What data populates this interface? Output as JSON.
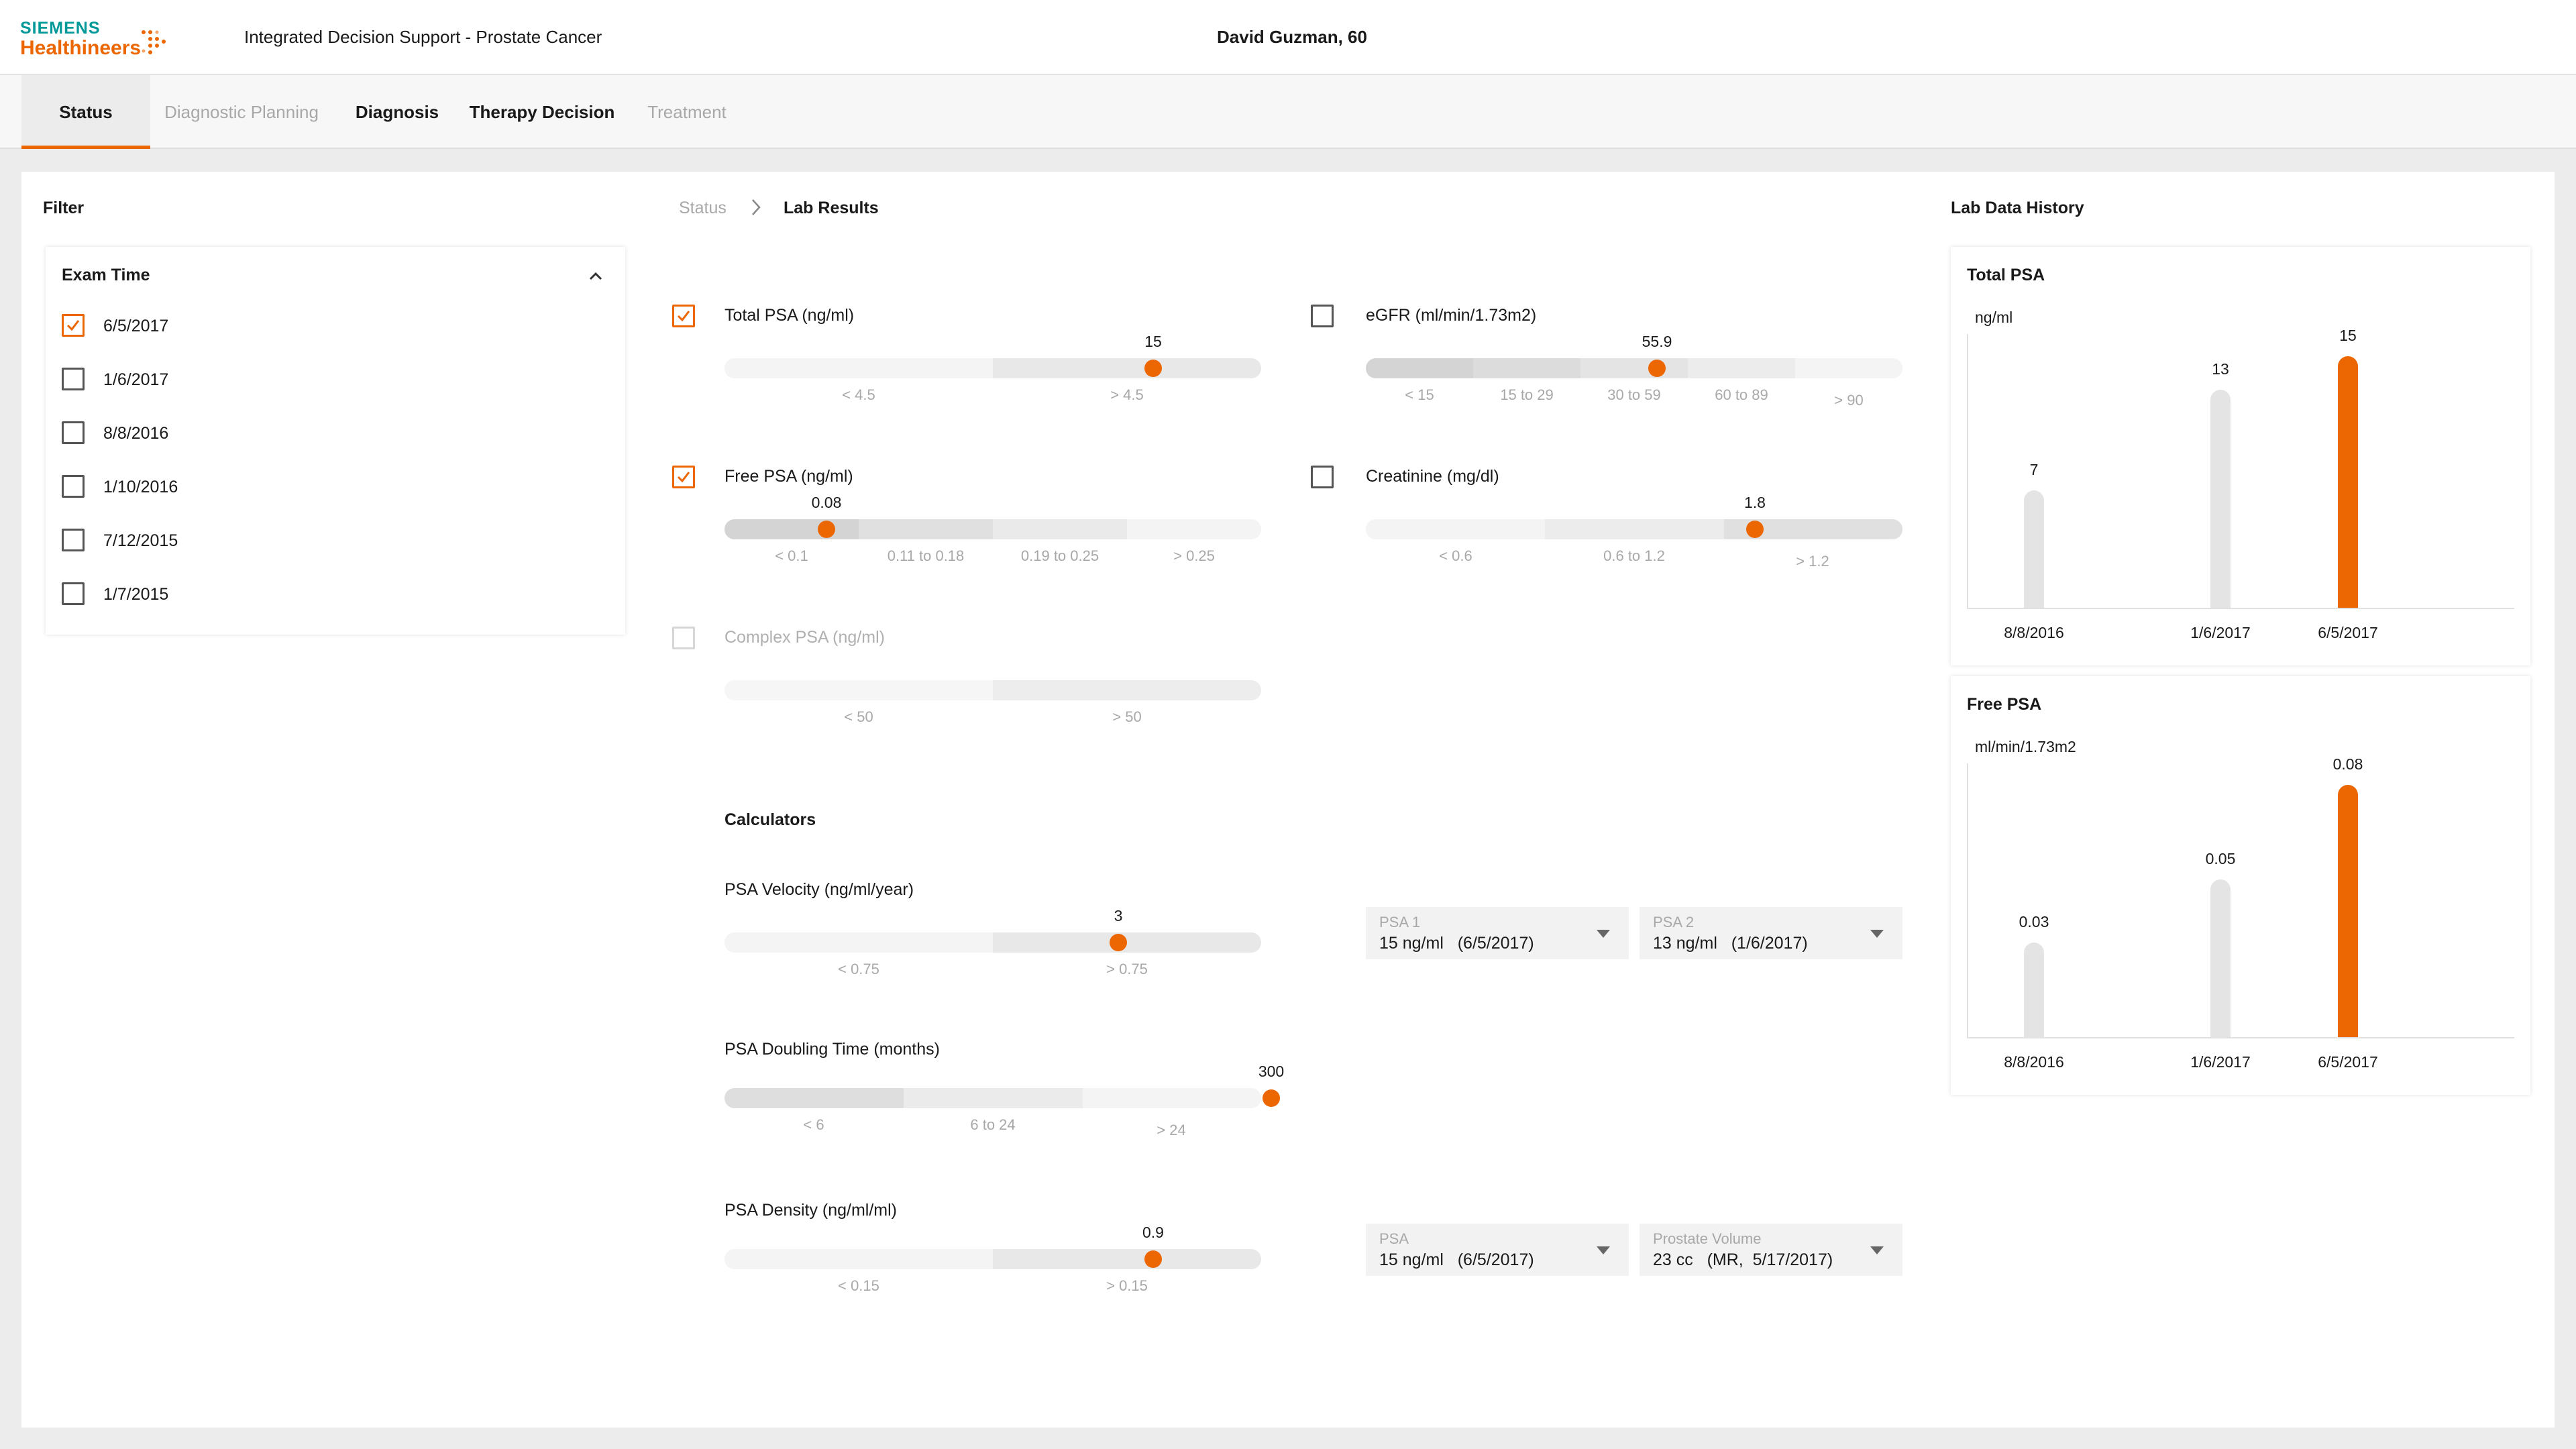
{
  "header": {
    "brand_line1": "SIEMENS",
    "brand_line2": "Healthineers",
    "app_title": "Integrated Decision Support - Prostate Cancer",
    "patient": "David Guzman, 60"
  },
  "tabs": [
    {
      "label": "Status",
      "state": "active"
    },
    {
      "label": "Diagnostic Planning",
      "state": "disabled"
    },
    {
      "label": "Diagnosis",
      "state": "enabled"
    },
    {
      "label": "Therapy Decision",
      "state": "enabled"
    },
    {
      "label": "Treatment",
      "state": "disabled"
    }
  ],
  "filter": {
    "title": "Filter",
    "group_title": "Exam Time",
    "items": [
      {
        "label": "6/5/2017",
        "checked": true
      },
      {
        "label": "1/6/2017",
        "checked": false
      },
      {
        "label": "8/8/2016",
        "checked": false
      },
      {
        "label": "1/10/2016",
        "checked": false
      },
      {
        "label": "7/12/2015",
        "checked": false
      },
      {
        "label": "1/7/2015",
        "checked": false
      }
    ]
  },
  "breadcrumb": {
    "parent": "Status",
    "current": "Lab Results"
  },
  "lab_results": {
    "total_psa": {
      "label": "Total PSA (ng/ml)",
      "checked": true,
      "value": "15",
      "ranges": [
        "< 4.5",
        "> 4.5"
      ]
    },
    "free_psa": {
      "label": "Free PSA (ng/ml)",
      "checked": true,
      "value": "0.08",
      "ranges": [
        "< 0.1",
        "0.11 to 0.18",
        "0.19 to 0.25",
        "> 0.25"
      ]
    },
    "complex_psa": {
      "label": "Complex PSA (ng/ml)",
      "checked": false,
      "disabled": true,
      "ranges": [
        "< 50",
        "> 50"
      ]
    },
    "egfr": {
      "label": "eGFR (ml/min/1.73m2)",
      "checked": false,
      "value": "55.9",
      "ranges": [
        "< 15",
        "15 to 29",
        "30 to 59",
        "60 to 89",
        "> 90"
      ]
    },
    "creatinine": {
      "label": "Creatinine (mg/dl)",
      "checked": false,
      "value": "1.8",
      "ranges": [
        "< 0.6",
        "0.6 to 1.2",
        "> 1.2"
      ]
    }
  },
  "calculators": {
    "title": "Calculators",
    "psa_velocity": {
      "label": "PSA Velocity (ng/ml/year)",
      "value": "3",
      "ranges": [
        "< 0.75",
        "> 0.75"
      ],
      "psa1": {
        "label": "PSA 1",
        "value": "15 ng/ml   (6/5/2017)"
      },
      "psa2": {
        "label": "PSA 2",
        "value": "13 ng/ml   (1/6/2017)"
      }
    },
    "psa_doubling": {
      "label": "PSA Doubling Time (months)",
      "value": "300",
      "ranges": [
        "< 6",
        "6 to 24",
        "> 24"
      ]
    },
    "psa_density": {
      "label": "PSA Density (ng/ml/ml)",
      "value": "0.9",
      "ranges": [
        "< 0.15",
        "> 0.15"
      ],
      "psa": {
        "label": "PSA",
        "value": "15 ng/ml   (6/5/2017)"
      },
      "volume": {
        "label": "Prostate Volume",
        "value": "23 cc   (MR,  5/17/2017)"
      }
    }
  },
  "history": {
    "title": "Lab Data History",
    "accent": "#ec6602",
    "neutral": "#e4e4e4"
  },
  "chart_data": [
    {
      "type": "bar",
      "title": "Total PSA",
      "ylabel": "ng/ml",
      "categories": [
        "8/8/2016",
        "1/6/2017",
        "6/5/2017"
      ],
      "values": [
        7,
        13,
        15
      ],
      "labels": [
        "7",
        "13",
        "15"
      ],
      "highlight_index": 2,
      "ylim": [
        0,
        16
      ]
    },
    {
      "type": "bar",
      "title": "Free PSA",
      "ylabel": "ml/min/1.73m2",
      "categories": [
        "8/8/2016",
        "1/6/2017",
        "6/5/2017"
      ],
      "values": [
        0.03,
        0.05,
        0.08
      ],
      "labels": [
        "0.03",
        "0.05",
        "0.08"
      ],
      "highlight_index": 2,
      "ylim": [
        0,
        0.085
      ]
    }
  ]
}
